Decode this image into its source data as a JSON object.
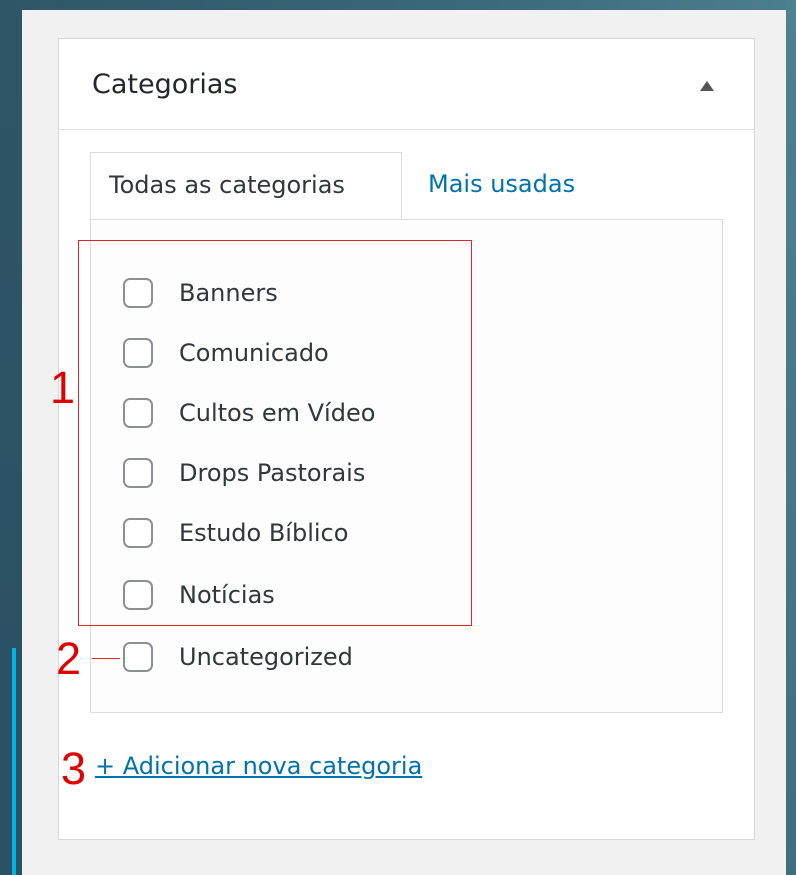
{
  "panel": {
    "title": "Categorias",
    "tabs": [
      {
        "label": "Todas as categorias",
        "active": true
      },
      {
        "label": "Mais usadas",
        "active": false
      }
    ],
    "categories": [
      {
        "label": "Banners",
        "checked": false
      },
      {
        "label": "Comunicado",
        "checked": false
      },
      {
        "label": "Cultos em Vídeo",
        "checked": false
      },
      {
        "label": "Drops Pastorais",
        "checked": false
      },
      {
        "label": "Estudo Bíblico",
        "checked": false
      },
      {
        "label": "Notícias",
        "checked": false
      },
      {
        "label": "Uncategorized",
        "checked": false
      }
    ],
    "add_link": "+ Adicionar nova categoria",
    "toggle_icon": "triangle-up-icon"
  },
  "annotations": [
    "1",
    "2",
    "3"
  ],
  "colors": {
    "link": "#0073aa",
    "annotation_red": "#e00000",
    "background_dark": "#2f5667"
  }
}
